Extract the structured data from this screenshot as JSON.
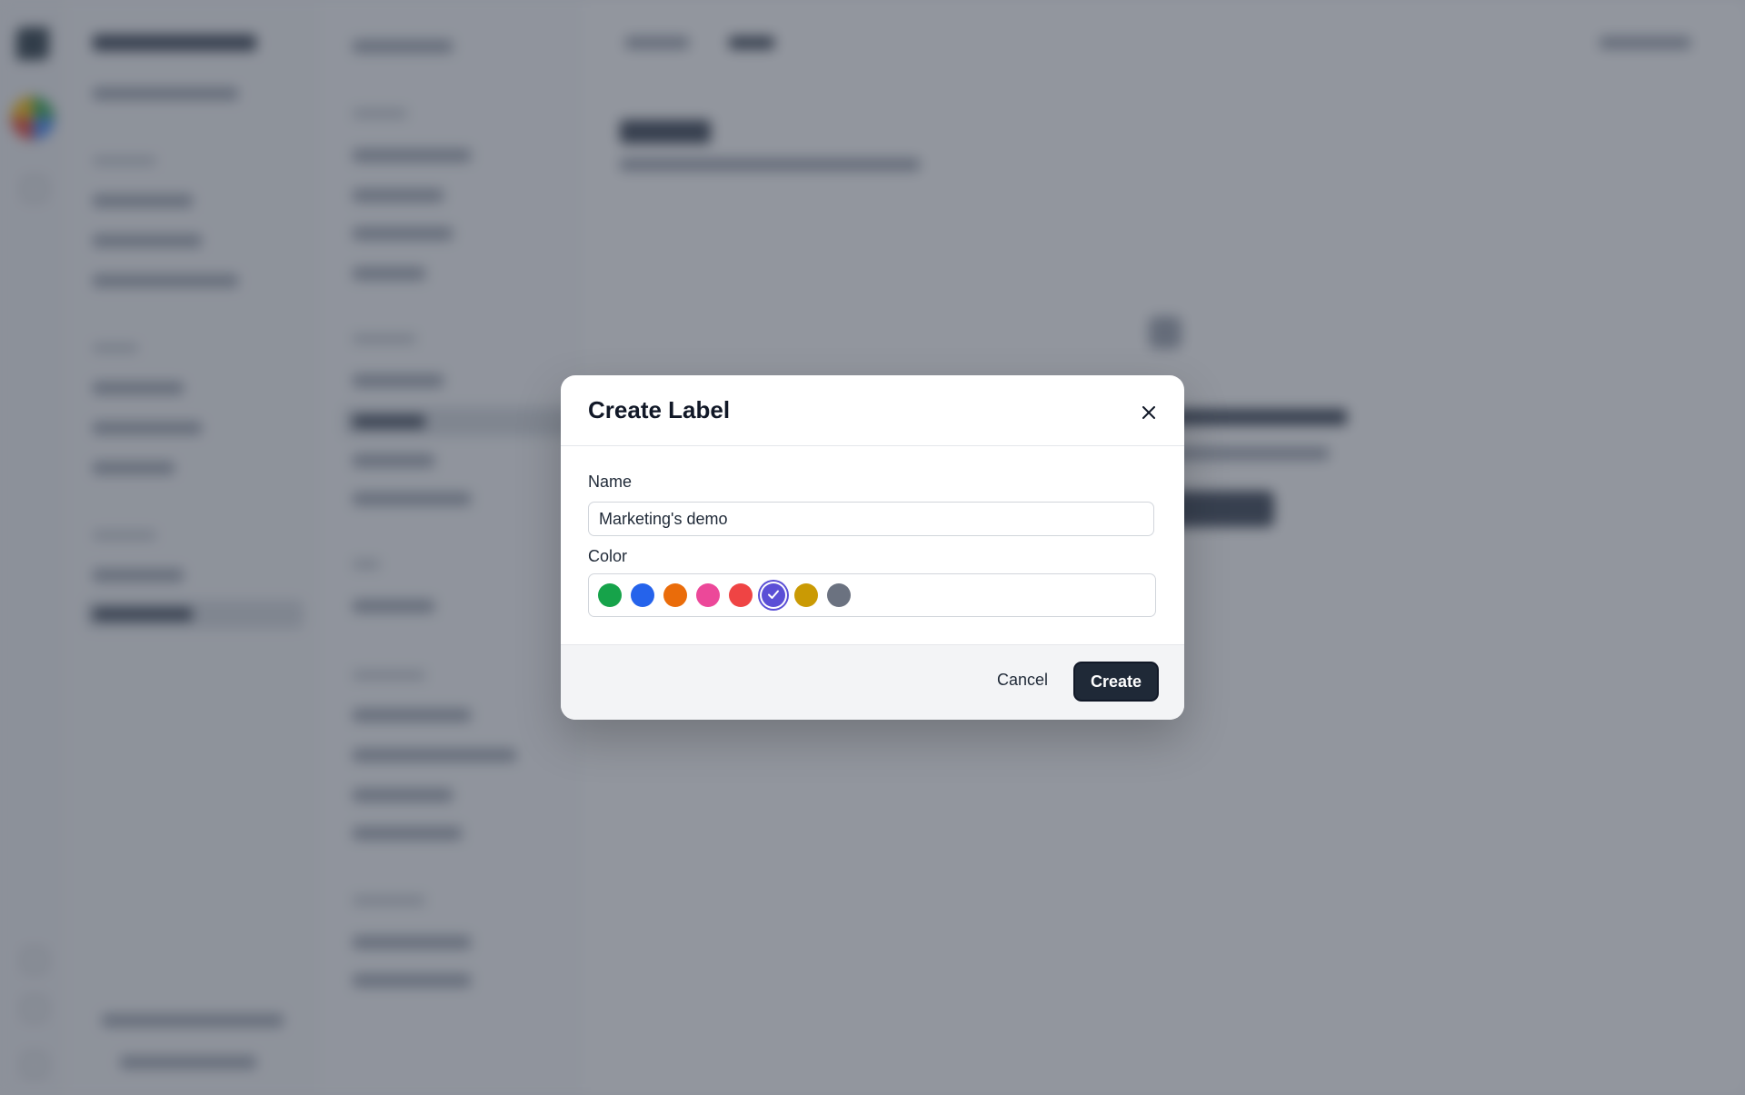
{
  "modal": {
    "title": "Create Label",
    "close_icon": "close-icon",
    "name_label": "Name",
    "name_value": "Marketing's demo",
    "color_label": "Color",
    "colors": [
      {
        "name": "green",
        "hex": "#16a34a",
        "selected": false
      },
      {
        "name": "blue",
        "hex": "#2563eb",
        "selected": false
      },
      {
        "name": "orange",
        "hex": "#ea6c0a",
        "selected": false
      },
      {
        "name": "pink",
        "hex": "#ec4899",
        "selected": false
      },
      {
        "name": "red",
        "hex": "#ef4444",
        "selected": false
      },
      {
        "name": "indigo",
        "hex": "#5b4fd6",
        "selected": true
      },
      {
        "name": "yellow",
        "hex": "#ca9a04",
        "selected": false
      },
      {
        "name": "gray",
        "hex": "#6b7280",
        "selected": false
      }
    ],
    "cancel_label": "Cancel",
    "create_label": "Create"
  },
  "theme": {
    "overlay": "rgba(56,63,78,0.55)",
    "primary_button": "#1f2937"
  }
}
